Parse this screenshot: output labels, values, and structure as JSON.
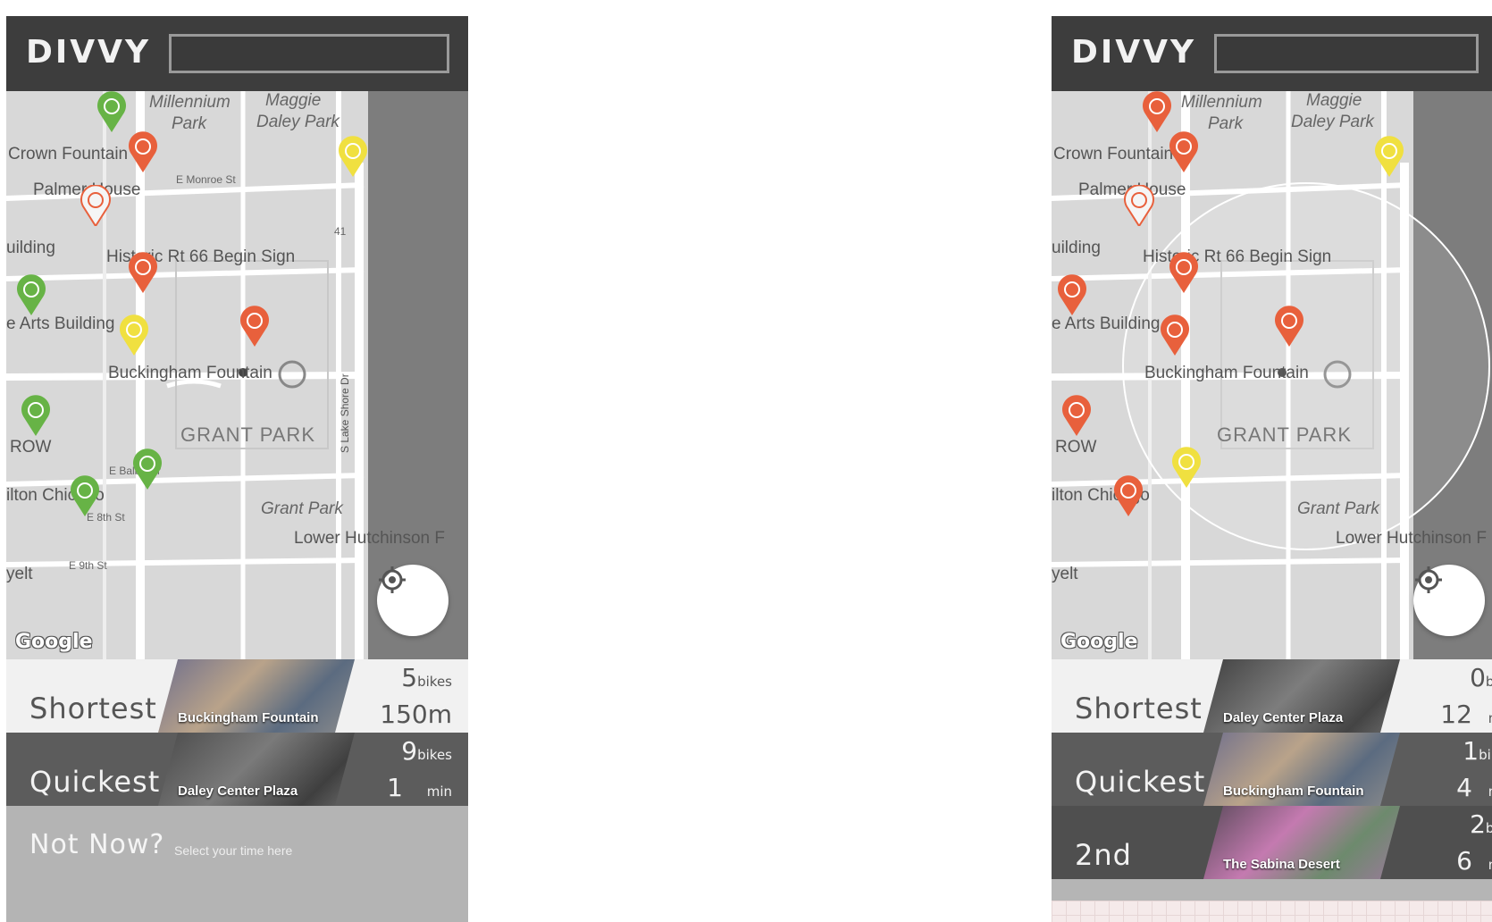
{
  "brand": "DIVVY",
  "map_labels": {
    "millennium": "Millennium",
    "park": "Park",
    "maggie": "Maggie",
    "daley_park": "Daley Park",
    "crown_fountain": "Crown Fountain",
    "palmer_house": "Palmer House",
    "monroe_st": "E Monroe St",
    "building": "uilding",
    "rt66": "Historic Rt 66 Begin Sign",
    "arts_building": "e Arts Building",
    "buckingham": "Buckingham Fountain",
    "grant_park_caps": "GRANT PARK",
    "row": "ROW",
    "hilton": "ilton Chicago",
    "balbo": "E Balbo Dr",
    "e8th": "E 8th St",
    "grant_park": "Grant Park",
    "lower_hutch": "Lower Hutchinson F",
    "e9th": "E 9th St",
    "velt": "yelt",
    "lake_shore": "S Lake Shore Dr",
    "route41": "41",
    "google": "Google"
  },
  "left": {
    "rows": [
      {
        "label": "Shortest",
        "station": "Buckingham Fountain",
        "count": "5",
        "count_unit": "bikes",
        "value": "150m",
        "unit": ""
      },
      {
        "label": "Quickest",
        "station": "Daley Center Plaza",
        "count": "9",
        "count_unit": "bikes",
        "value": "1",
        "unit": "min"
      }
    ],
    "not_now": {
      "title": "Not Now?",
      "subtitle": "Select your time here"
    }
  },
  "right": {
    "rows": [
      {
        "label": "Shortest",
        "station": "Daley Center Plaza",
        "count": "0",
        "count_unit": "bike",
        "value": "12",
        "unit": "min"
      },
      {
        "label": "Quickest",
        "station": "Buckingham Fountain",
        "count": "1",
        "count_unit": "bikes",
        "value": "4",
        "unit": "min"
      },
      {
        "label": "2nd",
        "station": "The Sabina Desert",
        "count": "2",
        "count_unit": "bike",
        "value": "6",
        "unit": "min"
      }
    ]
  },
  "colors": {
    "header": "#3d3d3d",
    "map_bg": "#d6d6d6",
    "pin_red": "#e8603c",
    "pin_green": "#67b346",
    "pin_yellow": "#f0e040"
  }
}
